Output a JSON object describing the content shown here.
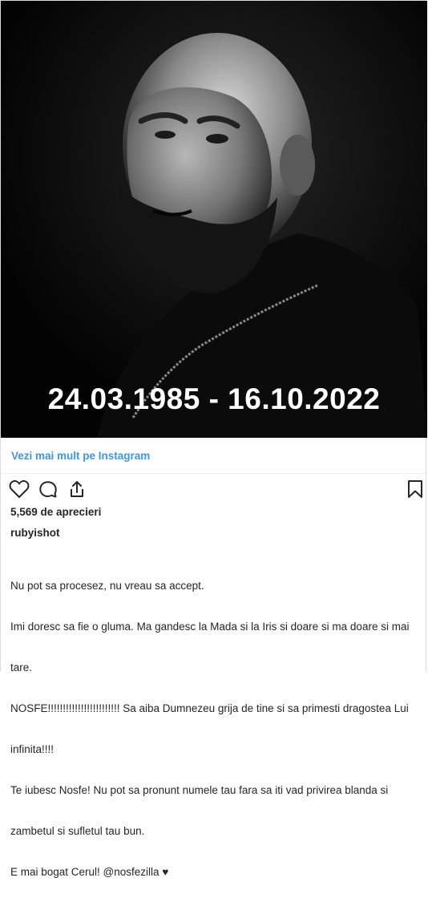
{
  "post": {
    "date_overlay": "24.03.1985 - 16.10.2022",
    "view_more_link": "Vezi mai mult pe Instagram",
    "likes": "5,569 de aprecieri",
    "username": "rubyishot",
    "caption_lines": [
      "Nu pot sa procesez, nu vreau sa accept.",
      "Imi doresc sa fie o gluma. Ma gandesc la Mada si la Iris si doare si ma doare si mai",
      "tare.",
      "NOSFE!!!!!!!!!!!!!!!!!!!!!!!! Sa aiba Dumnezeu grija de tine si sa primesti dragostea Lui",
      "infinita!!!!",
      "Te iubesc Nosfe! Nu pot sa pronunt numele tau fara sa iti vad privirea blanda si",
      "zambetul si sufletul tau bun.",
      "E mai bogat Cerul! @nosfezilla ♥"
    ]
  },
  "icons": {
    "like": "heart-icon",
    "comment": "comment-icon",
    "share": "share-icon",
    "save": "bookmark-icon"
  },
  "colors": {
    "link": "#3897f0",
    "text": "#262626",
    "photo_bg": "#050505"
  }
}
